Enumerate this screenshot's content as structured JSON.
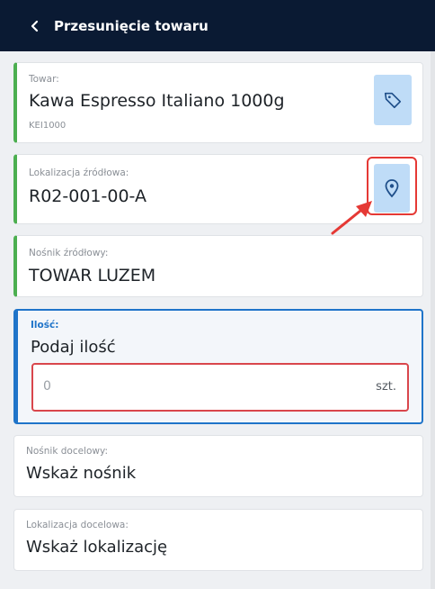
{
  "header": {
    "title": "Przesunięcie towaru",
    "back_icon": "chevron-left-icon"
  },
  "product": {
    "label": "Towar:",
    "name": "Kawa Espresso Italiano 1000g",
    "code": "KEI1000",
    "action_icon": "tag-icon"
  },
  "source_location": {
    "label": "Lokalizacja źródłowa:",
    "value": "R02-001-00-A",
    "action_icon": "map-pin-icon"
  },
  "source_carrier": {
    "label": "Nośnik źródłowy:",
    "value": "TOWAR LUZEM"
  },
  "quantity": {
    "label": "Ilość:",
    "prompt": "Podaj ilość",
    "placeholder": "0",
    "unit": "szt."
  },
  "target_carrier": {
    "label": "Nośnik docelowy:",
    "value": "Wskaż nośnik"
  },
  "target_location": {
    "label": "Lokalizacja docelowa:",
    "value": "Wskaż lokalizację"
  },
  "colors": {
    "header_bg": "#0a1a33",
    "accent_green": "#4caf50",
    "accent_blue": "#1f74c9",
    "icon_button_bg": "#bfdcf7",
    "annotation_red": "#e53935"
  }
}
